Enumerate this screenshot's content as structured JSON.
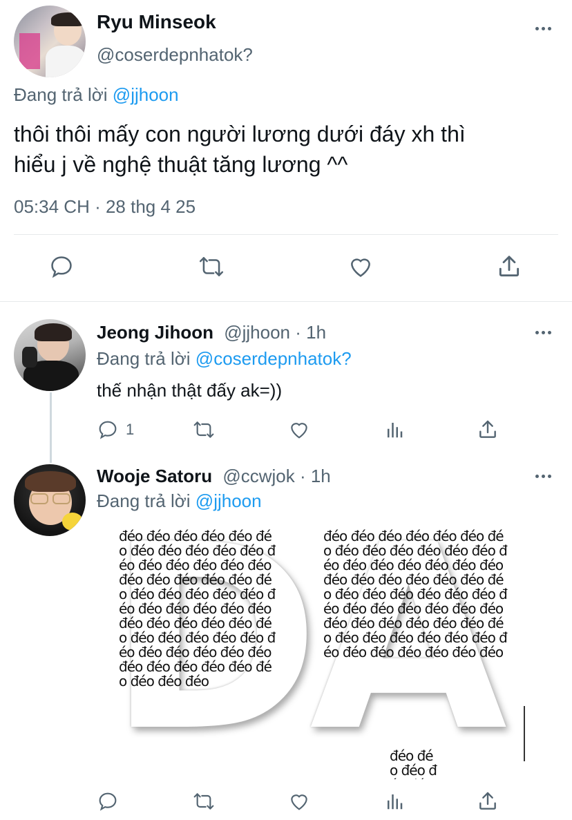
{
  "main_tweet": {
    "author_name": "Ryu Minseok",
    "author_handle": "@coserdepnhatok?",
    "reply_prefix": "Đang trả lời",
    "reply_to": "@jjhoon",
    "text_line1": "thôi thôi mấy con người lương dưới đáy xh thì",
    "text_line2": "hiểu j về nghệ thuật tăng lương ^^",
    "timestamp": "05:34 CH · 28 thg 4 25"
  },
  "reply1": {
    "author_name": "Jeong Jihoon",
    "author_handle": "@jjhoon",
    "time": "· 1h",
    "reply_prefix": "Đang trả lời",
    "reply_to": "@coserdepnhatok?",
    "text": "thế nhận thật đấy ak=))",
    "reply_count": "1"
  },
  "reply2": {
    "author_name": "Wooje Satoru",
    "author_handle": "@ccwjok",
    "time": "· 1h",
    "reply_prefix": "Đang trả lời",
    "reply_to": "@jjhoon",
    "media_word": "đéo",
    "media_letters": [
      "D",
      "A"
    ]
  },
  "colors": {
    "accent": "#1d9bf0",
    "muted": "#536471"
  }
}
